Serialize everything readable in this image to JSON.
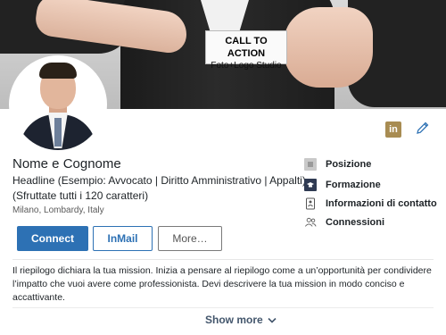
{
  "banner": {
    "card_line1": "CALL TO ACTION",
    "card_line2": "Foto+Logo Studio"
  },
  "profile": {
    "name": "Nome e Cognome",
    "headline_line1": "Headline (Esempio: Avvocato | Diritto Amministrativo | Appalti)",
    "headline_line2": "(Sfruttate tutti i 120 caratteri)",
    "location": "Milano, Lombardy, Italy"
  },
  "actions": {
    "connect_label": "Connect",
    "inmail_label": "InMail",
    "more_label": "More…"
  },
  "sidebar": {
    "items": [
      {
        "label": "Posizione",
        "icon": "position-icon"
      },
      {
        "label": "Formazione",
        "icon": "education-icon"
      },
      {
        "label": "Informazioni di contatto",
        "icon": "contact-info-icon"
      },
      {
        "label": "Connessioni",
        "icon": "connections-icon"
      }
    ]
  },
  "summary": {
    "text": "Il riepilogo dichiara la tua mission. Inizia a pensare al riepilogo come a un’opportunità per condividere l’impatto che vuoi avere come professionista. Devi descrivere la tua mission in modo conciso e accattivante.",
    "show_more_label": "Show more"
  },
  "icons": {
    "linkedin_text": "in"
  },
  "colors": {
    "primary": "#2d71b4",
    "linkedin_badge": "#a88c52",
    "background": "#ffffff"
  }
}
